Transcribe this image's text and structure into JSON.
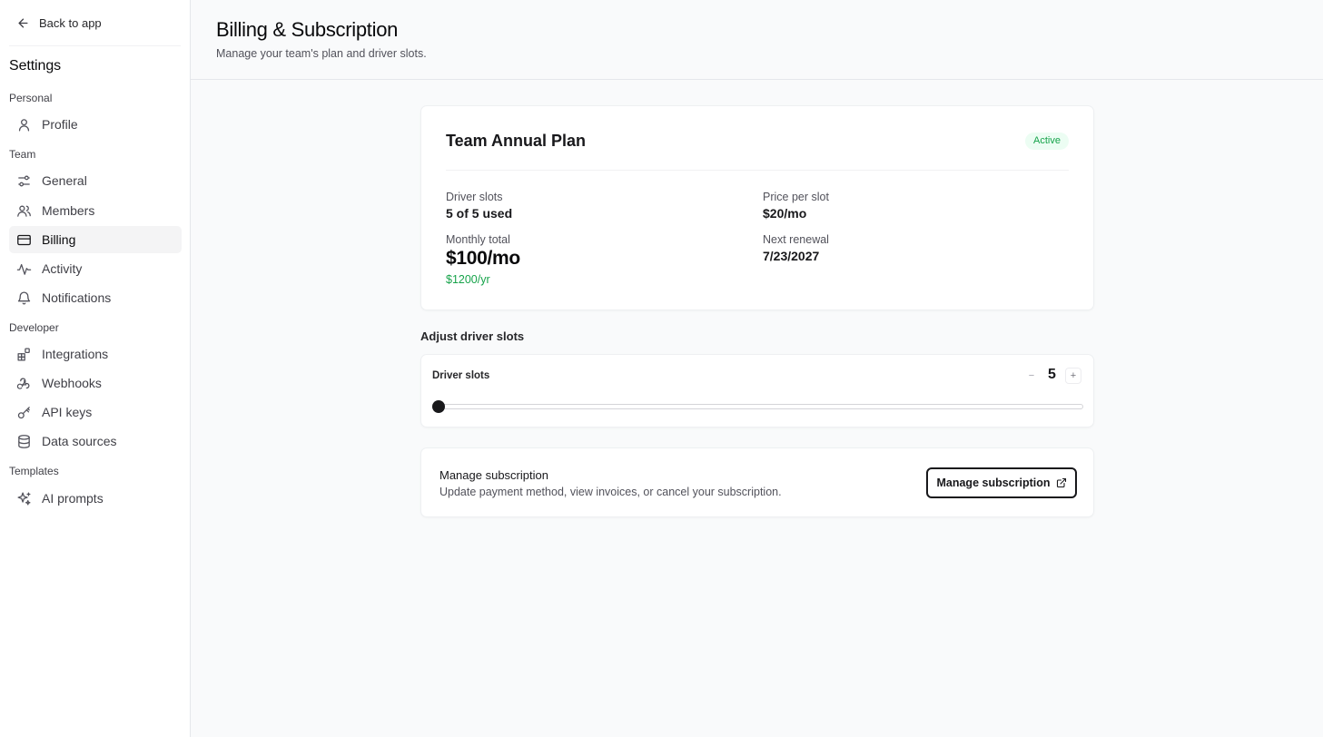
{
  "sidebar": {
    "back_label": "Back to app",
    "title": "Settings",
    "groups": {
      "personal": "Personal",
      "team": "Team",
      "developer": "Developer",
      "templates": "Templates"
    },
    "items": {
      "profile": {
        "label": "Profile",
        "icon": "user-icon"
      },
      "general": {
        "label": "General",
        "icon": "sliders-icon"
      },
      "members": {
        "label": "Members",
        "icon": "users-icon"
      },
      "billing": {
        "label": "Billing",
        "icon": "credit-card-icon",
        "active": true
      },
      "activity": {
        "label": "Activity",
        "icon": "activity-icon"
      },
      "notifications": {
        "label": "Notifications",
        "icon": "bell-icon"
      },
      "integrations": {
        "label": "Integrations",
        "icon": "blocks-icon"
      },
      "webhooks": {
        "label": "Webhooks",
        "icon": "webhook-icon"
      },
      "api_keys": {
        "label": "API keys",
        "icon": "key-icon"
      },
      "data_sources": {
        "label": "Data sources",
        "icon": "database-icon"
      },
      "ai_prompts": {
        "label": "AI prompts",
        "icon": "sparkles-icon"
      }
    }
  },
  "header": {
    "title": "Billing & Subscription",
    "subtitle": "Manage your team's plan and driver slots."
  },
  "plan": {
    "name": "Team Annual Plan",
    "status": "Active",
    "driver_slots_label": "Driver slots",
    "driver_slots_value": "5 of 5 used",
    "price_label": "Price per slot",
    "price_value": "$20/mo",
    "monthly_label": "Monthly total",
    "monthly_value": "$100/mo",
    "yearly_value": "$1200/yr",
    "renewal_label": "Next renewal",
    "renewal_value": "7/23/2027"
  },
  "adjust": {
    "section_title": "Adjust driver slots",
    "label": "Driver slots",
    "minus": "−",
    "plus": "+",
    "value": "5",
    "slider_fraction": 0
  },
  "manage": {
    "title": "Manage subscription",
    "description": "Update payment method, view invoices, or cancel your subscription.",
    "button_label": "Manage subscription",
    "button_icon": "external-link-icon"
  },
  "colors": {
    "accent": "#18181b",
    "success": "#16a34a",
    "success_bg": "#ecfdf3"
  }
}
